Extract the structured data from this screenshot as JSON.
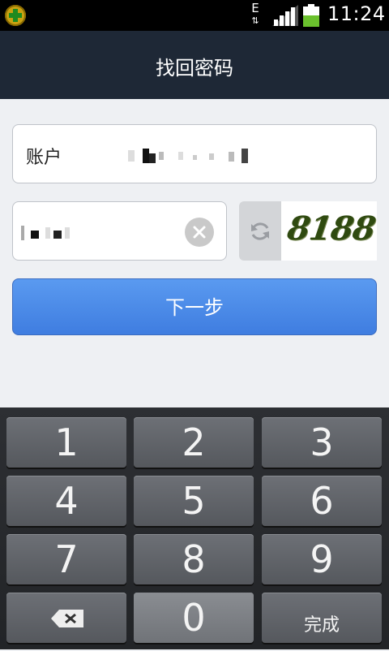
{
  "status_bar": {
    "network_type": "E",
    "network_arrows": "⇅",
    "time": "11:24",
    "battery_level": 0.55
  },
  "header": {
    "title": "找回密码"
  },
  "form": {
    "account_label": "账户",
    "account_value_masked": true,
    "captcha_value_masked": true,
    "captcha_image_text": "8188",
    "next_button_label": "下一步"
  },
  "keyboard": {
    "keys": [
      "1",
      "2",
      "3",
      "4",
      "5",
      "6",
      "7",
      "8",
      "9",
      "0"
    ],
    "done_label": "完成"
  },
  "colors": {
    "title_bar": "#1e2836",
    "primary_button": "#4a8ae8",
    "keyboard_bg": "#262a2e"
  }
}
